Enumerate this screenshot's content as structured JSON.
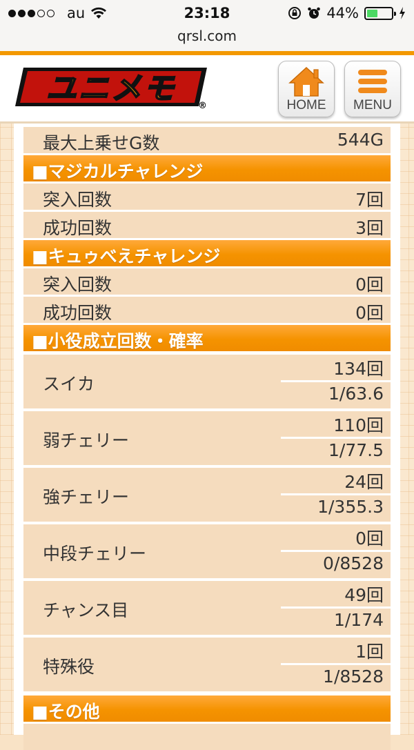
{
  "status_bar": {
    "carrier": "au",
    "time": "23:18",
    "battery": "44%",
    "battery_level": 0.44
  },
  "url": "qrsl.com",
  "header": {
    "logo_text": "ユニメモ",
    "logo_mark": "®",
    "home_label": "HOME",
    "menu_label": "MENU"
  },
  "rows": [
    {
      "label": "最大上乗せG数",
      "value": "544G"
    }
  ],
  "sections": [
    {
      "title": "■マジカルチャレンジ",
      "rows": [
        {
          "label": "突入回数",
          "value": "7回"
        },
        {
          "label": "成功回数",
          "value": "3回"
        }
      ]
    },
    {
      "title": "■キュゥべえチャレンジ",
      "rows": [
        {
          "label": "突入回数",
          "value": "0回"
        },
        {
          "label": "成功回数",
          "value": "0回"
        }
      ]
    },
    {
      "title": "■小役成立回数・確率",
      "items": [
        {
          "label": "スイカ",
          "count": "134回",
          "prob": "1/63.6"
        },
        {
          "label": "弱チェリー",
          "count": "110回",
          "prob": "1/77.5"
        },
        {
          "label": "強チェリー",
          "count": "24回",
          "prob": "1/355.3"
        },
        {
          "label": "中段チェリー",
          "count": "0回",
          "prob": "0/8528"
        },
        {
          "label": "チャンス目",
          "count": "49回",
          "prob": "1/174"
        },
        {
          "label": "特殊役",
          "count": "1回",
          "prob": "1/8528"
        }
      ]
    },
    {
      "title": "■その他"
    }
  ],
  "colors": {
    "accent_orange": "#f39800",
    "row_bg": "#f5dcbe",
    "battery_green": "#4cd964"
  }
}
